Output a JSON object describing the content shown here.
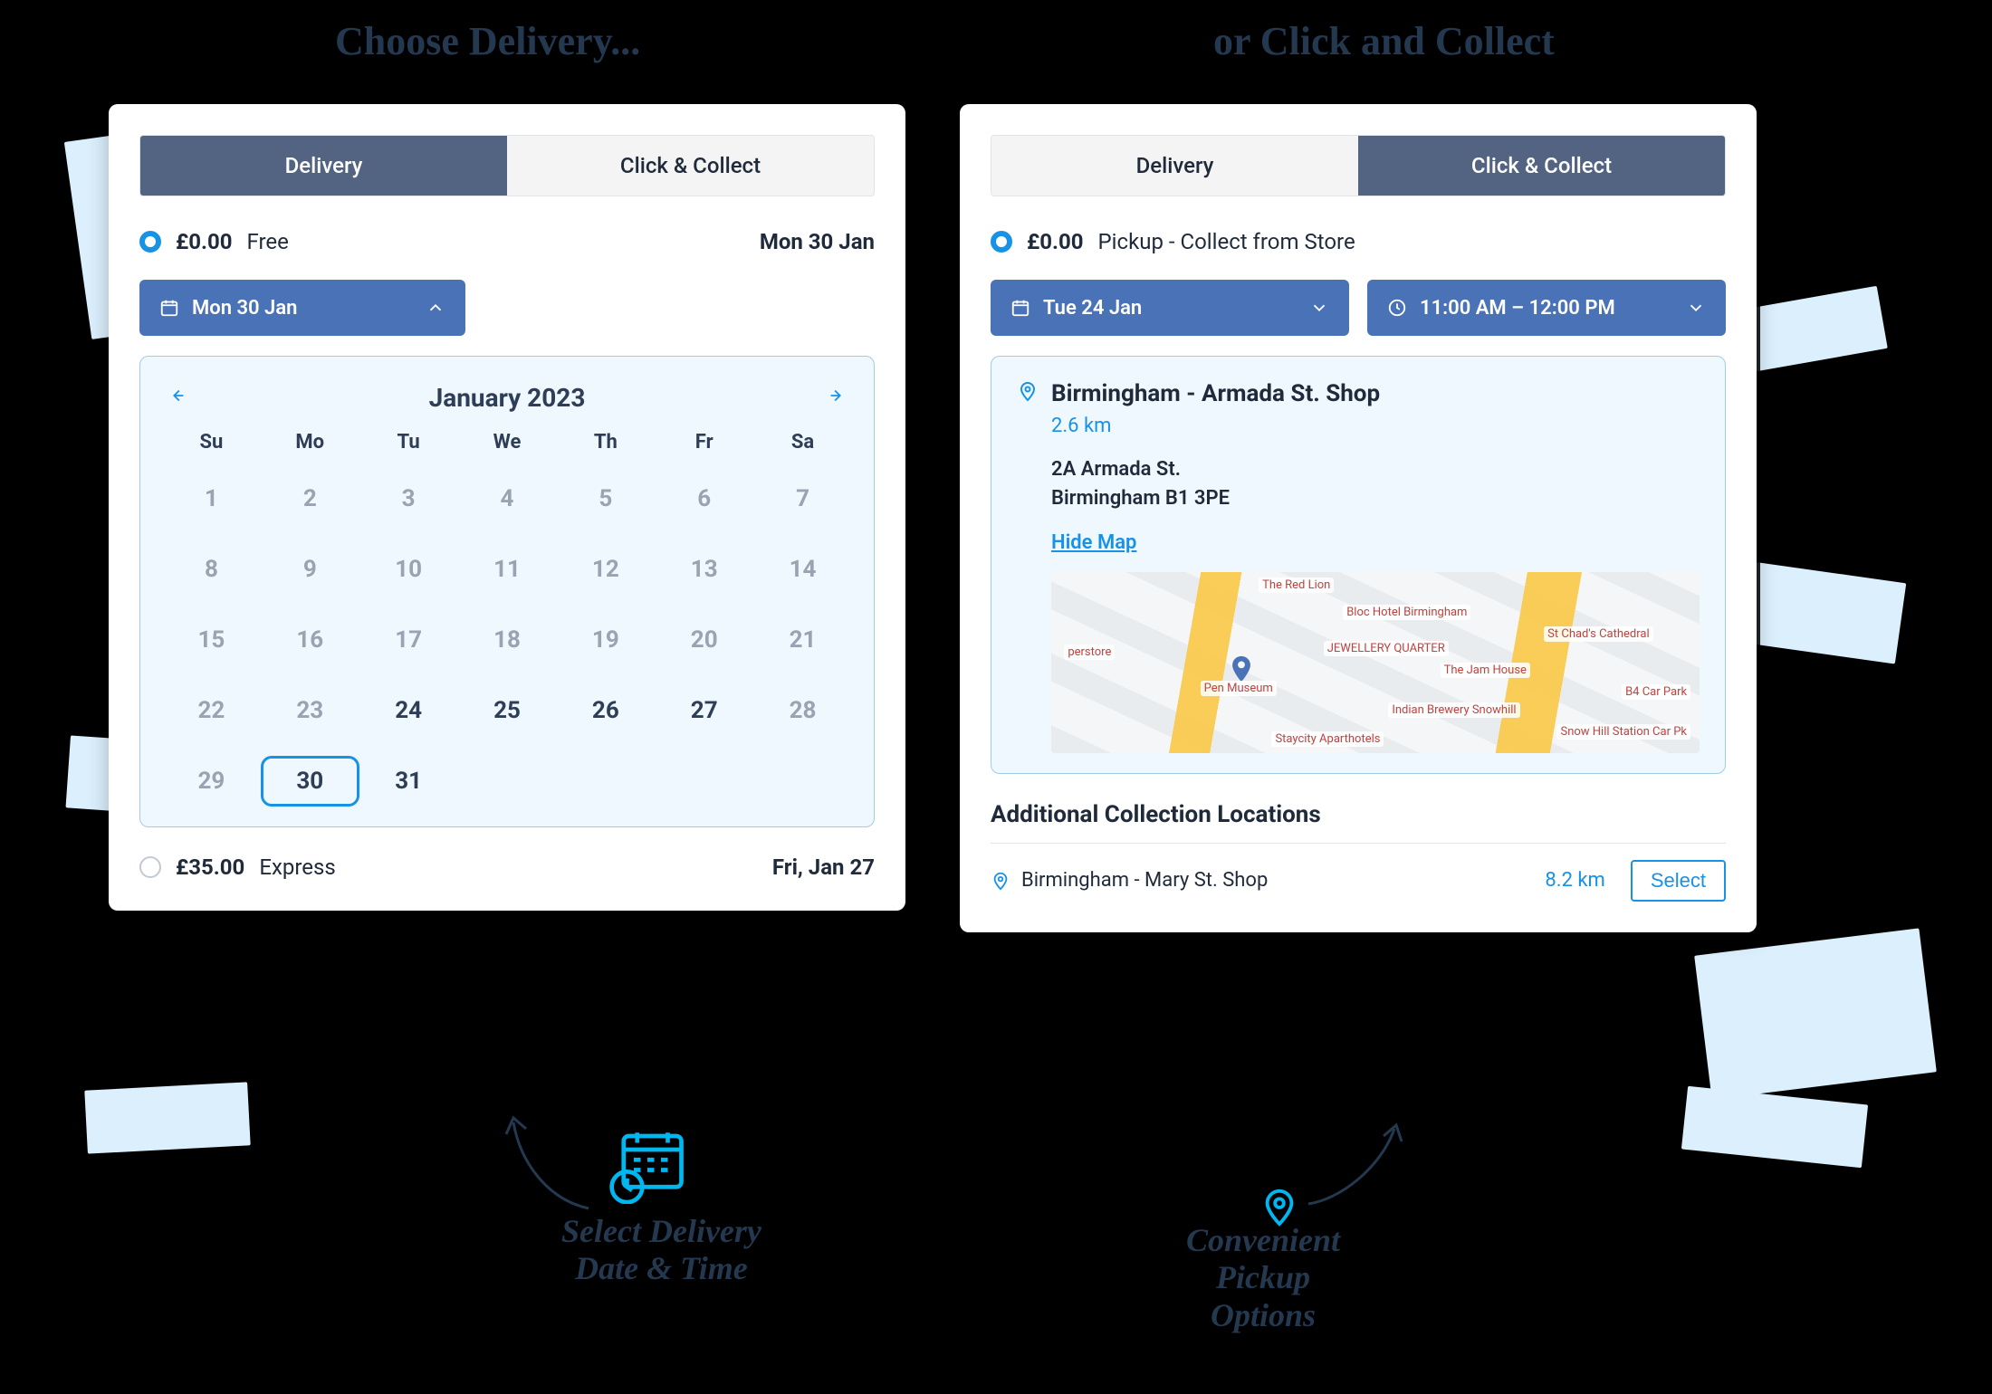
{
  "headlines": {
    "left": "Choose Delivery...",
    "right": "or Click and Collect"
  },
  "tabs": {
    "delivery": "Delivery",
    "collect": "Click & Collect"
  },
  "left_panel": {
    "option_free": {
      "price": "£0.00",
      "label": "Free",
      "date": "Mon 30 Jan"
    },
    "date_picker_label": "Mon 30 Jan",
    "calendar": {
      "title": "January 2023",
      "dow": [
        "Su",
        "Mo",
        "Tu",
        "We",
        "Th",
        "Fr",
        "Sa"
      ],
      "days": [
        {
          "n": "1"
        },
        {
          "n": "2"
        },
        {
          "n": "3"
        },
        {
          "n": "4"
        },
        {
          "n": "5"
        },
        {
          "n": "6"
        },
        {
          "n": "7"
        },
        {
          "n": "8"
        },
        {
          "n": "9"
        },
        {
          "n": "10"
        },
        {
          "n": "11"
        },
        {
          "n": "12"
        },
        {
          "n": "13"
        },
        {
          "n": "14"
        },
        {
          "n": "15"
        },
        {
          "n": "16"
        },
        {
          "n": "17"
        },
        {
          "n": "18"
        },
        {
          "n": "19"
        },
        {
          "n": "20"
        },
        {
          "n": "21"
        },
        {
          "n": "22"
        },
        {
          "n": "23"
        },
        {
          "n": "24",
          "enabled": true
        },
        {
          "n": "25",
          "enabled": true
        },
        {
          "n": "26",
          "enabled": true
        },
        {
          "n": "27",
          "enabled": true
        },
        {
          "n": "28"
        },
        {
          "n": "29"
        },
        {
          "n": "30",
          "enabled": true,
          "selected": true
        },
        {
          "n": "31",
          "enabled": true
        }
      ]
    },
    "option_express": {
      "price": "£35.00",
      "label": "Express",
      "date": "Fri, Jan 27"
    }
  },
  "right_panel": {
    "option_pickup": {
      "price": "£0.00",
      "label": "Pickup - Collect from Store"
    },
    "date_picker_label": "Tue 24 Jan",
    "time_picker_label": "11:00 AM – 12:00 PM",
    "location": {
      "name": "Birmingham - Armada St. Shop",
      "distance": "2.6 km",
      "addr1": "2A Armada St.",
      "addr2": "Birmingham B1 3PE",
      "hide_map": "Hide Map",
      "map_pois": [
        "The Red Lion",
        "Bloc Hotel Birmingham",
        "JEWELLERY QUARTER",
        "Pen Museum",
        "The Jam House",
        "Indian Brewery Snowhill",
        "St Chad's Cathedral",
        "B4 Car Park",
        "Snow Hill Station Car Pk",
        "Staycity Aparthotels",
        "perstore"
      ]
    },
    "additional_heading": "Additional Collection Locations",
    "alt": {
      "name": "Birmingham - Mary St. Shop",
      "distance": "8.2 km",
      "select": "Select"
    }
  },
  "callouts": {
    "one_a": "Select Delivery",
    "one_b": "Date & Time",
    "two_a": "Convenient",
    "two_b": "Pickup",
    "two_c": "Options"
  }
}
